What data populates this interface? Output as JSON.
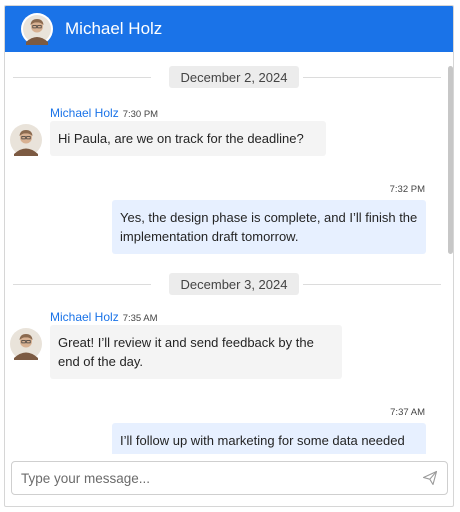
{
  "header": {
    "user_name": "Michael Holz"
  },
  "messages_panel": {
    "dividers": [
      "December 2, 2024",
      "December 3, 2024"
    ],
    "messages": [
      {
        "author": "Michael Holz",
        "time": "7:30 PM",
        "text": "Hi Paula, are we on track for the deadline?"
      },
      {
        "time": "7:32 PM",
        "text": "Yes, the design phase is complete, and I’ll finish the implementation draft tomorrow."
      },
      {
        "author": "Michael Holz",
        "time": "7:35 AM",
        "text": "Great! I’ll review it and send feedback by the end of the day."
      },
      {
        "time": "7:37 AM",
        "text": "I’ll follow up with marketing for some data needed for the next section."
      }
    ]
  },
  "composer": {
    "placeholder": "Type your message..."
  },
  "icons": {
    "avatar": "avatar-icon",
    "send": "send-icon"
  },
  "colors": {
    "header_bg": "#1a73e8",
    "outgoing_bubble": "#e7f0ff",
    "incoming_bubble": "#f4f4f4"
  }
}
